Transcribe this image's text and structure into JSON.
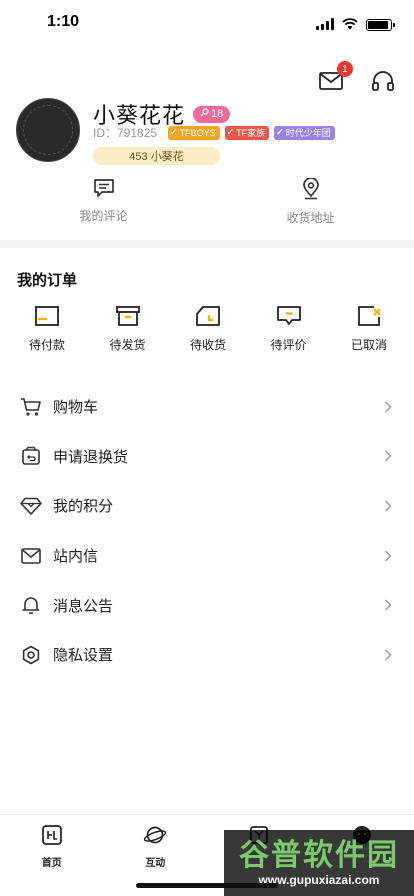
{
  "status_bar": {
    "time": "1:10",
    "battery_level": 0.9
  },
  "header_actions": {
    "message_icon": "envelope-icon",
    "message_badge": "1",
    "support_icon": "headphones-icon"
  },
  "profile": {
    "name": "小葵花花",
    "level": "18",
    "id_label": "ID：791825",
    "tags": [
      {
        "text": "TFBOYS",
        "color": "#f4a427"
      },
      {
        "text": "TF家族",
        "color": "#e8584a"
      },
      {
        "text": "时代少年团",
        "color": "#9b82e6"
      }
    ],
    "points": "453 小葵花"
  },
  "quick_links": [
    {
      "label": "我的评论",
      "icon": "comment-icon"
    },
    {
      "label": "收货地址",
      "icon": "location-pin-icon"
    }
  ],
  "orders": {
    "title": "我的订单",
    "items": [
      {
        "label": "待付款",
        "icon": "wallet-icon"
      },
      {
        "label": "待发货",
        "icon": "box-icon"
      },
      {
        "label": "待收货",
        "icon": "delivery-icon"
      },
      {
        "label": "待评价",
        "icon": "review-icon"
      },
      {
        "label": "已取消",
        "icon": "cancelled-icon"
      }
    ]
  },
  "menu": [
    {
      "label": "购物车",
      "icon": "cart-icon"
    },
    {
      "label": "申请退换货",
      "icon": "return-icon"
    },
    {
      "label": "我的积分",
      "icon": "diamond-icon"
    },
    {
      "label": "站内信",
      "icon": "mail-icon"
    },
    {
      "label": "消息公告",
      "icon": "bell-icon"
    },
    {
      "label": "隐私设置",
      "icon": "settings-icon"
    }
  ],
  "tab_bar": [
    {
      "label": "首页",
      "icon": "home-icon"
    },
    {
      "label": "互动",
      "icon": "planet-icon"
    },
    {
      "label": "",
      "icon": "shop-icon"
    },
    {
      "label": "",
      "icon": "avatar-icon"
    }
  ],
  "watermark": {
    "text": "谷普软件园",
    "url": "www.gupuxiazai.com"
  },
  "colors": {
    "accent": "#f4b400",
    "badge": "#e8382b",
    "level": "#f06b9c"
  }
}
